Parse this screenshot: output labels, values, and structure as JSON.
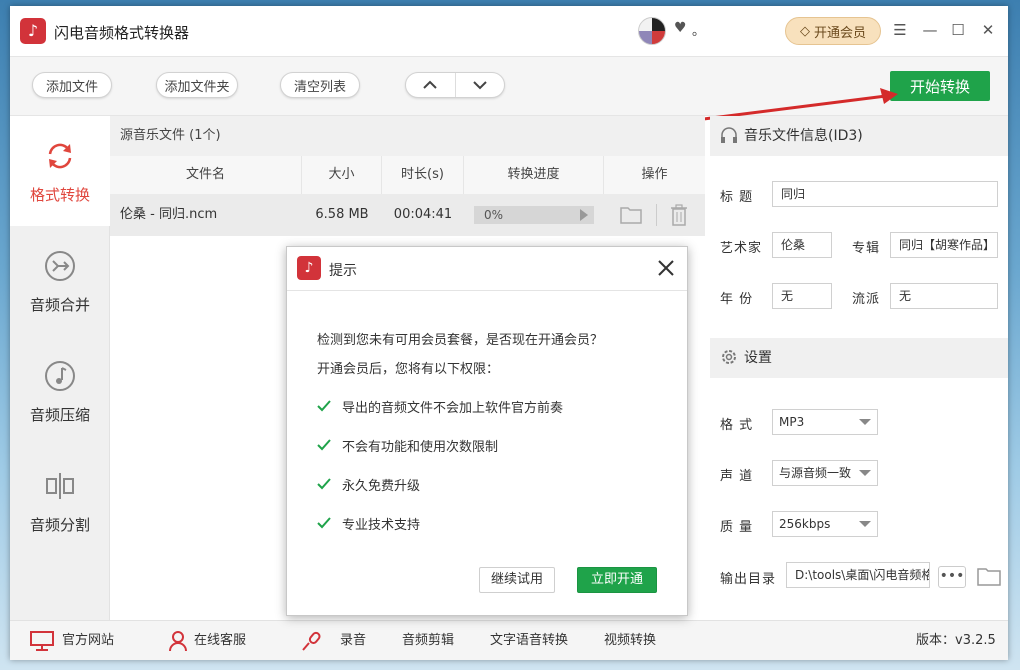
{
  "window": {
    "title": "闪电音频格式转换器",
    "user_name": "。",
    "vip_label": "开通会员",
    "controls": {
      "menu": "☰",
      "minimize": "—",
      "maximize": "☐",
      "close": "✕"
    }
  },
  "toolbar": {
    "add_file": "添加文件",
    "add_folder": "添加文件夹",
    "clear_list": "清空列表",
    "move_up": "︿",
    "move_down": "﹀",
    "start_convert": "开始转换"
  },
  "sidebar": {
    "items": [
      {
        "label": "格式转换",
        "icon": "refresh-icon",
        "active": true
      },
      {
        "label": "音频合并",
        "icon": "merge-icon",
        "active": false
      },
      {
        "label": "音频压缩",
        "icon": "music-note-icon",
        "active": false
      },
      {
        "label": "音频分割",
        "icon": "split-icon",
        "active": false
      }
    ]
  },
  "filelist": {
    "header": "源音乐文件 (1个)",
    "columns": [
      "文件名",
      "大小",
      "时长(s)",
      "转换进度",
      "操作"
    ],
    "rows": [
      {
        "name": "伦桑 - 同归.ncm",
        "size": "6.58 MB",
        "duration": "00:04:41",
        "progress": "0%",
        "progress_fraction": 0
      }
    ]
  },
  "info_panel": {
    "title": "音乐文件信息(ID3)",
    "title_label": "标  题",
    "title_value": "同归",
    "artist_label": "艺术家",
    "artist_value": "伦桑",
    "album_label": "专辑",
    "album_value": "同归【胡寒作品】",
    "year_label": "年  份",
    "year_value": "无",
    "genre_label": "流派",
    "genre_value": "无"
  },
  "settings": {
    "title": "设置",
    "format_label": "格  式",
    "format_value": "MP3",
    "channel_label": "声  道",
    "channel_value": "与源音频一致",
    "quality_label": "质  量",
    "quality_value": "256kbps",
    "output_label": "输出目录",
    "output_value": "D:\\tools\\桌面\\闪电音频格",
    "more": "•••"
  },
  "statusbar": {
    "website": "官方网站",
    "support": "在线客服",
    "record": "录音",
    "audio_edit": "音频剪辑",
    "tts": "文字语音转换",
    "video_convert": "视频转换",
    "version": "版本：v3.2.5"
  },
  "dialog": {
    "title": "提示",
    "line1": "检测到您未有可用会员套餐，是否现在开通会员？",
    "line2": "开通会员后，您将有以下权限：",
    "benefits": [
      "导出的音频文件不会加上软件官方前奏",
      "不会有功能和使用次数限制",
      "永久免费升级",
      "专业技术支持"
    ],
    "trial_button": "继续试用",
    "open_button": "立即开通"
  },
  "colors": {
    "accent_red": "#e0463d",
    "brand_green": "#1fa34a",
    "vip_gold": "#f8e1bd"
  }
}
